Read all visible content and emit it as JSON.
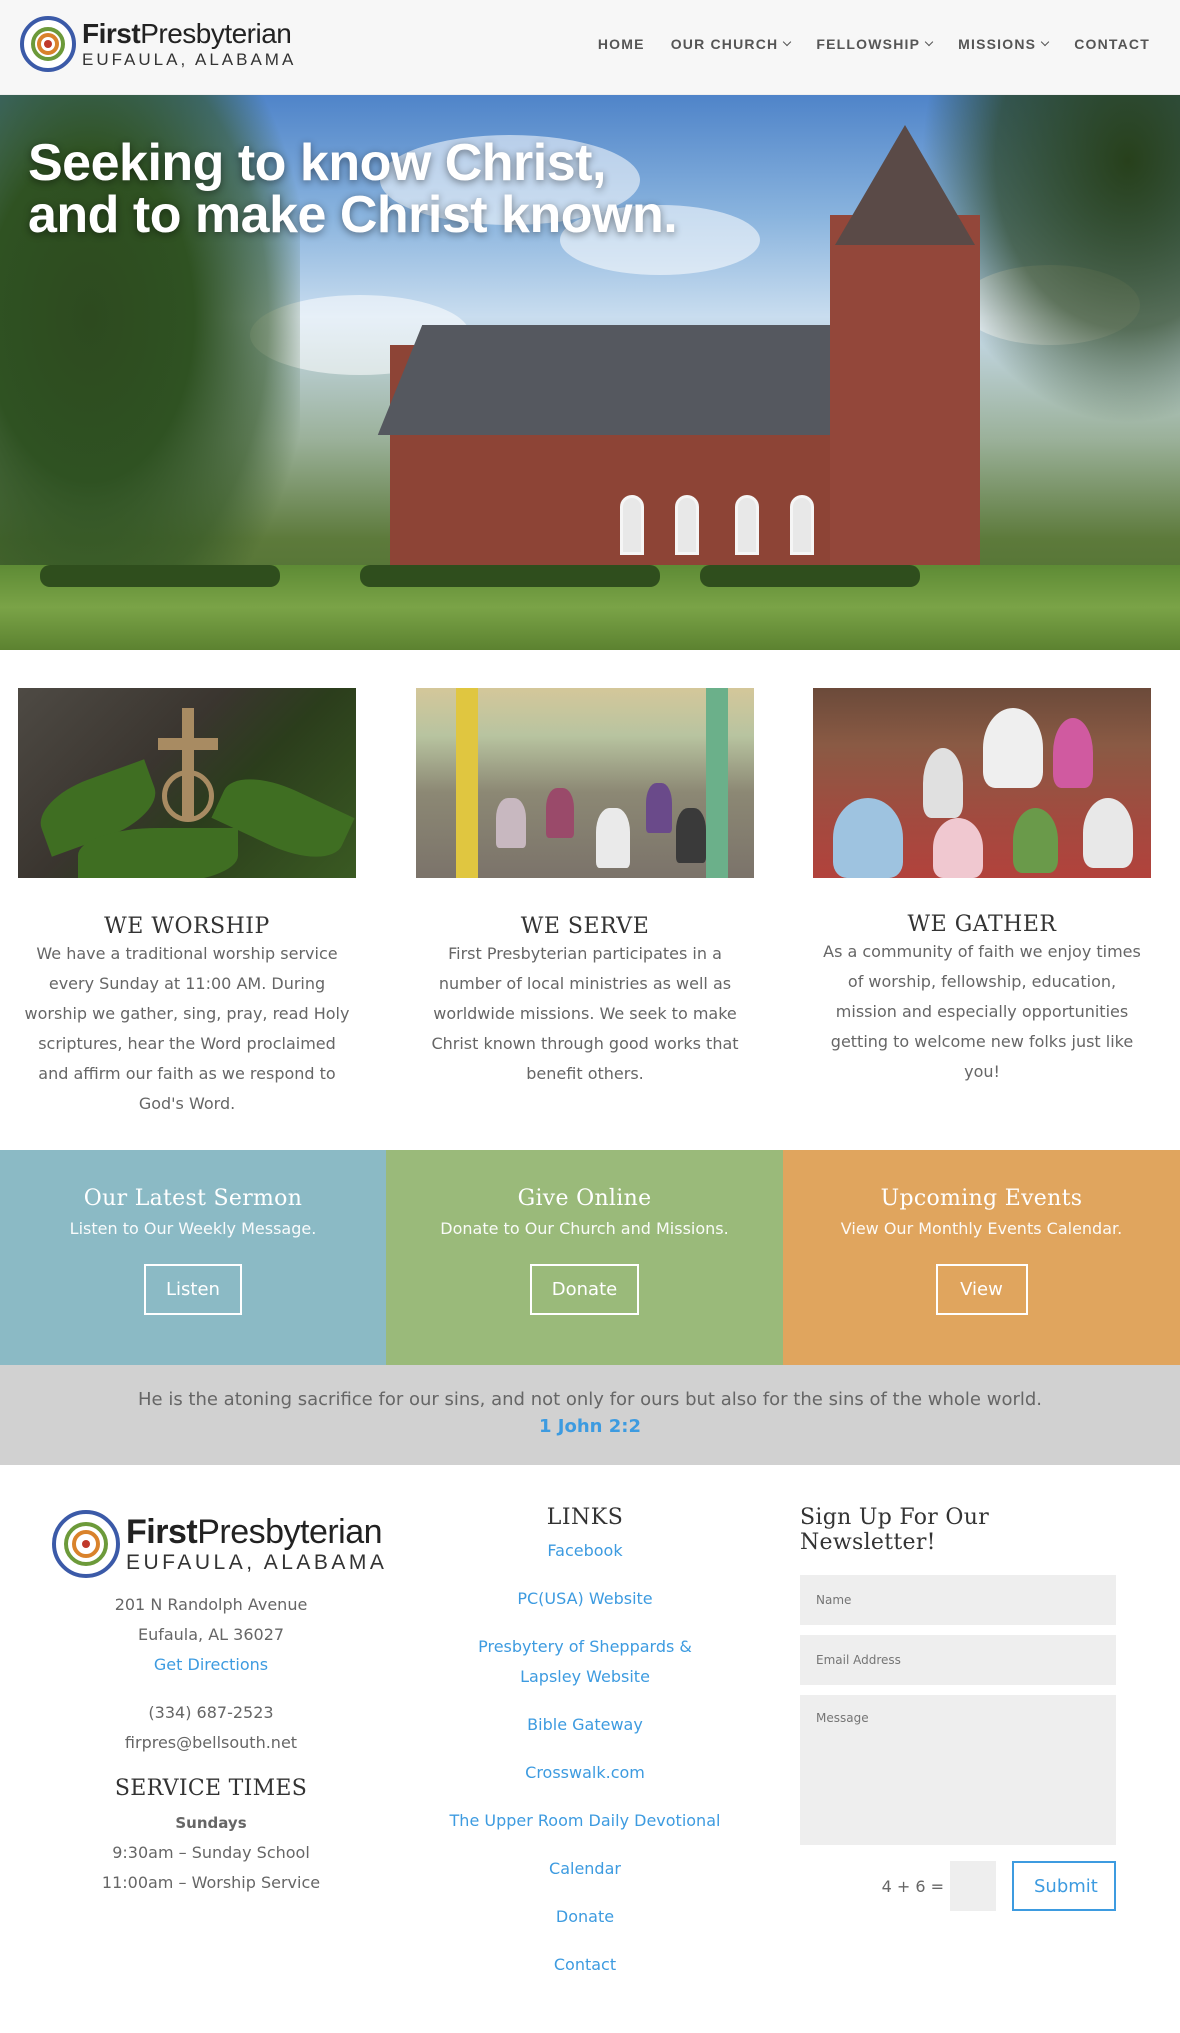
{
  "header": {
    "logo": {
      "title_bold": "First",
      "title_rest": "Presbyterian",
      "subtitle": "EUFAULA, ALABAMA"
    },
    "nav": [
      {
        "label": "HOME",
        "has_dropdown": false
      },
      {
        "label": "OUR CHURCH",
        "has_dropdown": true
      },
      {
        "label": "FELLOWSHIP",
        "has_dropdown": true
      },
      {
        "label": "MISSIONS",
        "has_dropdown": true
      },
      {
        "label": "CONTACT",
        "has_dropdown": false
      }
    ]
  },
  "hero": {
    "line1": "Seeking to know Christ,",
    "line2": "and to make Christ known."
  },
  "features": [
    {
      "title": "WE WORSHIP",
      "text": "We have a traditional worship service every Sunday at 11:00 AM. During worship we gather, sing, pray, read Holy scriptures, hear the Word proclaimed and affirm our faith as we respond to God's Word."
    },
    {
      "title": "WE SERVE",
      "text": "First Presbyterian participates in a number of local ministries as well as worldwide missions. We seek to make Christ known through good works that benefit others."
    },
    {
      "title": "WE GATHER",
      "text": "As a community of faith we enjoy times of worship, fellowship, education, mission and especially opportunities getting to welcome new folks just like you!"
    }
  ],
  "cta": [
    {
      "title": "Our Latest Sermon",
      "subtitle": "Listen to Our Weekly Message.",
      "button": "Listen",
      "color": "#8bbac5"
    },
    {
      "title": "Give Online",
      "subtitle": "Donate to Our Church and Missions.",
      "button": "Donate",
      "color": "#9aba7a"
    },
    {
      "title": "Upcoming Events",
      "subtitle": "View Our Monthly Events Calendar.",
      "button": "View",
      "color": "#e0a55e"
    }
  ],
  "verse": {
    "text": "He is the atoning sacrifice for our sins, and not only for ours but also for the sins of the whole world.",
    "reference": "1 John 2:2"
  },
  "footer": {
    "logo": {
      "title_bold": "First",
      "title_rest": "Presbyterian",
      "subtitle": "EUFAULA, ALABAMA"
    },
    "address_line1": "201 N Randolph Avenue",
    "address_line2": "Eufaula, AL 36027",
    "directions_link": "Get Directions",
    "phone": "(334) 687-2523",
    "email": "firpres@bellsouth.net",
    "service_times": {
      "heading": "SERVICE TIMES",
      "day": "Sundays",
      "item1": "9:30am – Sunday School",
      "item2": "11:00am – Worship Service"
    },
    "links": {
      "heading": "LINKS",
      "items": [
        "Facebook",
        "PC(USA) Website",
        "Presbytery of Sheppards & Lapsley Website",
        "Bible Gateway",
        "Crosswalk.com",
        "The Upper Room Daily Devotional",
        "Calendar",
        "Donate",
        "Contact"
      ]
    },
    "newsletter": {
      "heading": "Sign Up For Our Newsletter!",
      "name_placeholder": "Name",
      "email_placeholder": "Email Address",
      "message_placeholder": "Message",
      "captcha_label": "4 + 6 =",
      "submit_label": "Submit"
    }
  },
  "colors": {
    "link": "#3d9be0",
    "header_bg": "#f7f7f7",
    "verse_bg": "#d1d1d1"
  }
}
